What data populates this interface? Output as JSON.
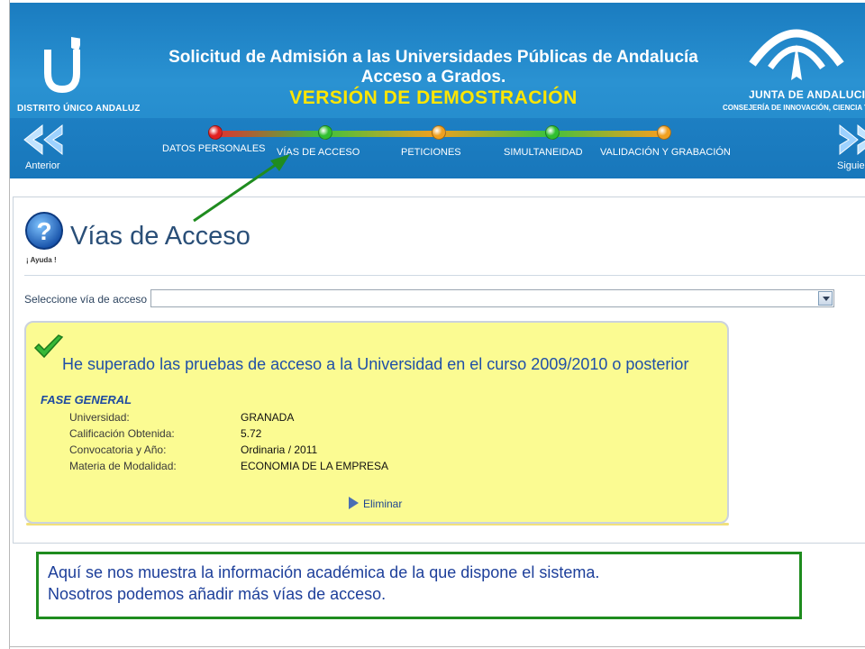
{
  "header": {
    "logo_label": "DISTRITO ÚNICO ANDALUZ",
    "title_line1": "Solicitud de Admisión a las Universidades Públicas de Andalucía",
    "title_line2": "Acceso a Grados.",
    "demo_label": "VERSIÓN DE DEMOSTRACIÓN",
    "junta_name": "JUNTA DE ANDALUCIA",
    "junta_dept": "CONSEJERÍA DE INNOVACIÓN, CIENCIA Y EMP",
    "prev_label": "Anterior",
    "next_label": "Siguie"
  },
  "steps": [
    {
      "label": "DATOS PERSONALES",
      "status_color": "#e02020"
    },
    {
      "label": "VÍAS DE ACCESO",
      "status_color": "#2fbf2f"
    },
    {
      "label": "PETICIONES",
      "status_color": "#f0a020"
    },
    {
      "label": "SIMULTANEIDAD",
      "status_color": "#2fbf2f"
    },
    {
      "label": "VALIDACIÓN Y GRABACIÓN",
      "status_color": "#f0a020"
    }
  ],
  "page": {
    "help_label": "¡ Ayuda !",
    "title": "Vías de Acceso",
    "select_label": "Seleccione vía de acceso",
    "select_value": ""
  },
  "access_card": {
    "title": "He superado las pruebas de acceso a la Universidad en el curso 2009/2010 o posterior",
    "phase": "FASE GENERAL",
    "fields": [
      {
        "label": "Universidad:",
        "value": "GRANADA"
      },
      {
        "label": "Calificación Obtenida:",
        "value": "5.72"
      },
      {
        "label": "Convocatoria y Año:",
        "value": "Ordinaria / 2011"
      },
      {
        "label": "Materia de Modalidad:",
        "value": "ECONOMIA DE LA EMPRESA"
      }
    ],
    "delete_label": "Eliminar"
  },
  "note": {
    "line1": "Aquí se nos muestra la información académica de la que dispone el sistema.",
    "line2": "Nosotros podemos añadir más vías de acceso."
  },
  "colors": {
    "header_blue": "#1f86c8",
    "demo_yellow": "#ffe600",
    "card_yellow": "#fbfb92",
    "note_border": "#1f8c1f",
    "arrow_green": "#1f8c1f"
  }
}
